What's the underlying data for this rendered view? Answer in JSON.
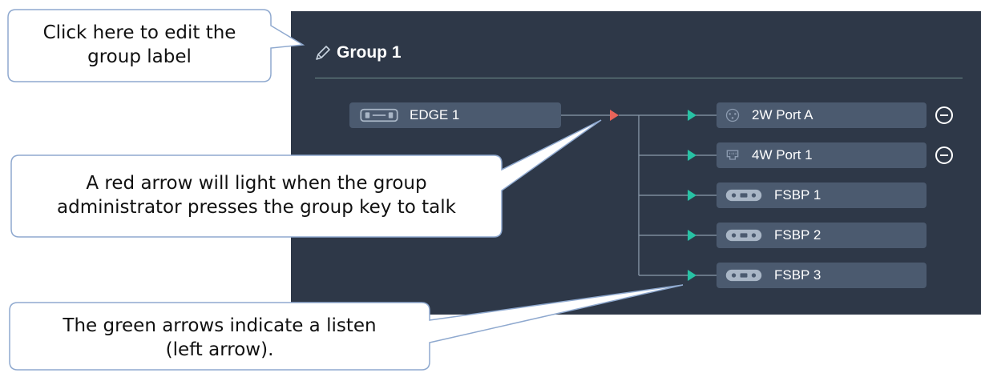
{
  "panel": {
    "background": "#2e3848",
    "group_label": "Group 1",
    "edit_icon": "pencil-icon"
  },
  "source": {
    "label": "EDGE 1",
    "icon": "beltpack-edge-icon"
  },
  "talk_arrow_color": "#e8645a",
  "listen_arrow_color": "#27c2a4",
  "members": [
    {
      "label": "2W Port A",
      "icon": "2w-port-icon",
      "removable": true
    },
    {
      "label": "4W Port 1",
      "icon": "4w-port-icon",
      "removable": true
    },
    {
      "label": "FSBP 1",
      "icon": "beltpack-icon",
      "removable": false
    },
    {
      "label": "FSBP 2",
      "icon": "beltpack-icon",
      "removable": false
    },
    {
      "label": "FSBP 3",
      "icon": "beltpack-icon",
      "removable": false
    }
  ],
  "remove_icon": "minus-circle-icon",
  "callouts": {
    "edit_label": {
      "line1": "Click here to edit the",
      "line2": "group label"
    },
    "red_arrow": {
      "line1": "A red arrow will light when the group",
      "line2": "administrator presses the group key to talk"
    },
    "green_arrow": {
      "line1": "The green arrows indicate a listen",
      "line2": "(left arrow)."
    }
  }
}
